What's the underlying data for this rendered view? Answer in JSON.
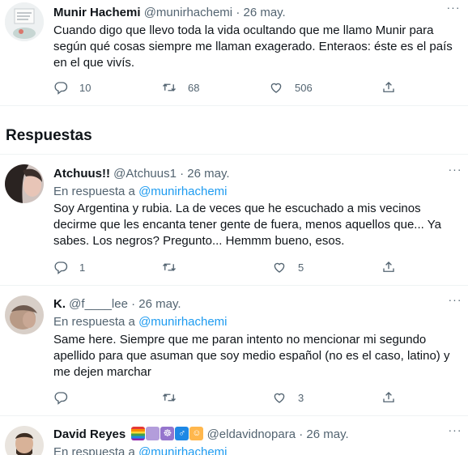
{
  "main_tweet": {
    "name": "Munir Hachemi",
    "handle": "@munirhachemi",
    "dot": "·",
    "date": "26 may.",
    "text": "Cuando digo que llevo toda la vida ocultando que me llamo Munir para según qué cosas siempre me llaman exagerado. Enteraos: éste es el país en el que vivís.",
    "replies": "10",
    "retweets": "68",
    "likes": "506",
    "more": "···"
  },
  "section_title": "Respuestas",
  "replies": [
    {
      "name": "Atchuus!!",
      "handle": "@Atchuus1",
      "dot": "·",
      "date": "26 may.",
      "reply_prefix": "En respuesta a ",
      "reply_mention": "@munirhachemi",
      "text": "Soy Argentina y rubia. La de veces que he escuchado a mis vecinos decirme que les encanta tener gente de fuera, menos aquellos que... Ya sabes. Los negros? Pregunto... Hemmm bueno, esos.",
      "replies": "1",
      "retweets": "",
      "likes": "5",
      "more": "···"
    },
    {
      "name": "K.",
      "handle": "@f____lee",
      "dot": "·",
      "date": "26 may.",
      "reply_prefix": "En respuesta a ",
      "reply_mention": "@munirhachemi",
      "text": "Same here. Siempre que me paran intento no mencionar mi segundo apellido para que asuman que soy medio español (no es el caso, latino) y me dejen marchar",
      "replies": "",
      "retweets": "",
      "likes": "3",
      "more": "···"
    },
    {
      "name": "David Reyes",
      "handle": "@eldavidnopara",
      "dot": "·",
      "date": "26 may.",
      "reply_prefix": "En respuesta a ",
      "reply_mention": "@munirhachemi",
      "more": "···"
    }
  ],
  "colors": {
    "accent": "#1d9bf0",
    "secondary_text": "#536471",
    "divider": "#eff3f4"
  },
  "icons": [
    "reply-icon",
    "retweet-icon",
    "like-icon",
    "share-icon",
    "more-icon"
  ]
}
